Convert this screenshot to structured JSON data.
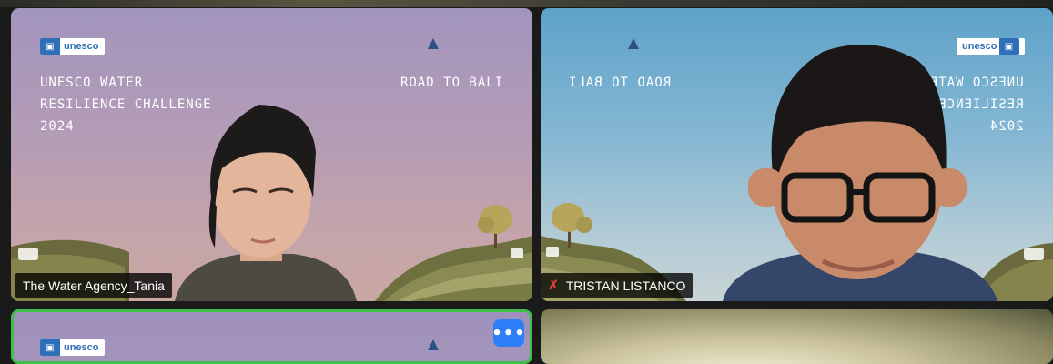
{
  "tiles": [
    {
      "name": "The Water Agency_Tania",
      "brand": "unesco",
      "title_lines": "UNESCO WATER\nRESILIENCE CHALLENGE\n2024",
      "tagline": "ROAD TO BALI",
      "muted": false
    },
    {
      "name": "TRISTAN LISTANCO",
      "brand": "unesco",
      "title_lines": "UNESCO WATER\nRESILIENCE CH\n2024",
      "tagline": "ROAD TO BALI",
      "muted": true
    },
    {
      "brand": "unesco",
      "more_label": "•••"
    }
  ],
  "colors": {
    "active_speaker_border": "#3fbf4a",
    "more_button": "#2d7ff9",
    "muted_mic": "#e03c3c",
    "unesco_blue": "#2f6fb7"
  }
}
